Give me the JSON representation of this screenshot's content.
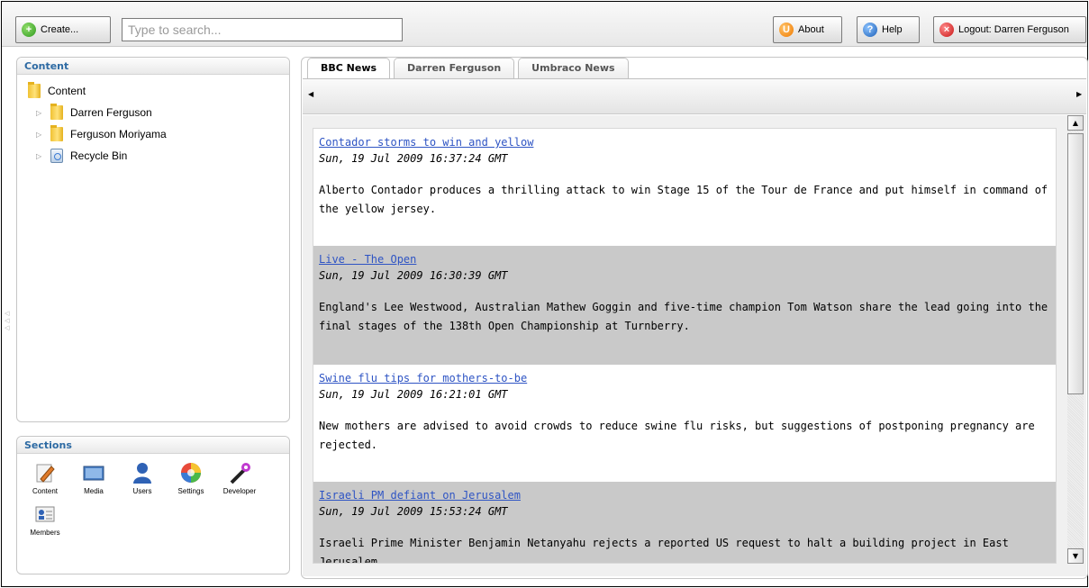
{
  "toolbar": {
    "create_label": "Create...",
    "search_placeholder": "Type to search...",
    "about_label": "About",
    "help_label": "Help",
    "logout_label": "Logout: Darren Ferguson"
  },
  "content_panel": {
    "title": "Content",
    "tree": [
      {
        "label": "Content",
        "icon": "folder-icon",
        "expandable": false
      },
      {
        "label": "Darren Ferguson",
        "icon": "folder-icon",
        "expandable": true
      },
      {
        "label": "Ferguson Moriyama",
        "icon": "folder-icon",
        "expandable": true
      },
      {
        "label": "Recycle Bin",
        "icon": "recycle-bin-icon",
        "expandable": true
      }
    ]
  },
  "sections_panel": {
    "title": "Sections",
    "items": [
      {
        "label": "Content",
        "icon": "content-edit-icon"
      },
      {
        "label": "Media",
        "icon": "media-icon"
      },
      {
        "label": "Users",
        "icon": "users-icon"
      },
      {
        "label": "Settings",
        "icon": "settings-icon"
      },
      {
        "label": "Developer",
        "icon": "developer-icon"
      },
      {
        "label": "Members",
        "icon": "members-icon"
      }
    ]
  },
  "tabs": [
    {
      "label": "BBC News",
      "active": true
    },
    {
      "label": "Darren Ferguson",
      "active": false
    },
    {
      "label": "Umbraco News",
      "active": false
    }
  ],
  "feed": [
    {
      "title": "Contador storms to win and yellow",
      "date": "Sun, 19 Jul 2009 16:37:24 GMT",
      "desc": "Alberto Contador produces a thrilling attack to win Stage 15 of the Tour de France and put himself in command of the yellow jersey."
    },
    {
      "title": "Live - The Open",
      "date": "Sun, 19 Jul 2009 16:30:39 GMT",
      "desc": "England's Lee Westwood, Australian Mathew Goggin and five-time champion Tom Watson share the lead going into the final stages of the 138th Open Championship at Turnberry."
    },
    {
      "title": "Swine flu tips for mothers-to-be",
      "date": "Sun, 19 Jul 2009 16:21:01 GMT",
      "desc": "New mothers are advised to avoid crowds to reduce swine flu risks, but suggestions of postponing pregnancy are rejected."
    },
    {
      "title": "Israeli PM defiant on Jerusalem",
      "date": "Sun, 19 Jul 2009 15:53:24 GMT",
      "desc": "Israeli Prime Minister Benjamin Netanyahu rejects a reported US request to halt a building project in East Jerusalem."
    }
  ]
}
